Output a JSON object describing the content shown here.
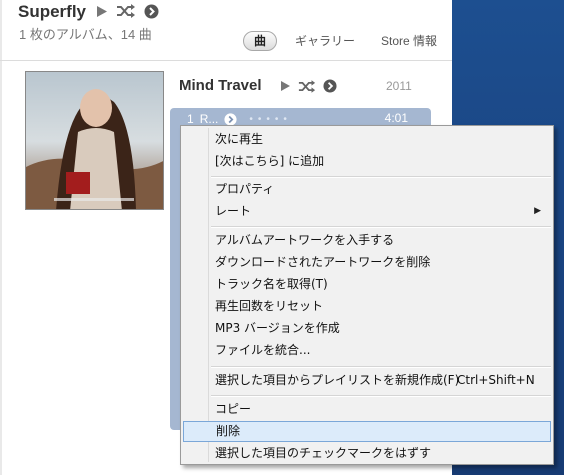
{
  "header": {
    "artist": "Superfly",
    "subtitle": "1 枚のアルバム、14 曲",
    "tabs": [
      {
        "label": "曲",
        "active": true
      },
      {
        "label": "ギャラリー",
        "active": false
      },
      {
        "label": "Store 情報",
        "active": false
      }
    ]
  },
  "album": {
    "title": "Mind Travel",
    "year": "2011",
    "icons": [
      "play-icon",
      "shuffle-icon",
      "more-arrow-icon"
    ]
  },
  "track": {
    "number": "1",
    "name": "R...",
    "time": "4:01"
  },
  "context_menu": {
    "items": [
      {
        "label": "次に再生"
      },
      {
        "label": "[次はこちら] に追加"
      },
      {
        "label": "プロパティ"
      },
      {
        "label": "レート",
        "submenu": true
      },
      {
        "label": "アルバムアートワークを入手する"
      },
      {
        "label": "ダウンロードされたアートワークを削除"
      },
      {
        "label": "トラック名を取得(T)"
      },
      {
        "label": "再生回数をリセット"
      },
      {
        "label": "MP3 バージョンを作成"
      },
      {
        "label": "ファイルを統合..."
      },
      {
        "label": "選択した項目からプレイリストを新規作成(F)",
        "shortcut": "Ctrl+Shift+N"
      },
      {
        "label": "コピー"
      },
      {
        "label": "削除",
        "highlighted": true
      },
      {
        "label": "選択した項目のチェックマークをはずす"
      }
    ]
  },
  "colors": {
    "selection": "#a5b7d1",
    "menu_highlight": "#dcebfa",
    "desktop": "#1d4f90"
  }
}
